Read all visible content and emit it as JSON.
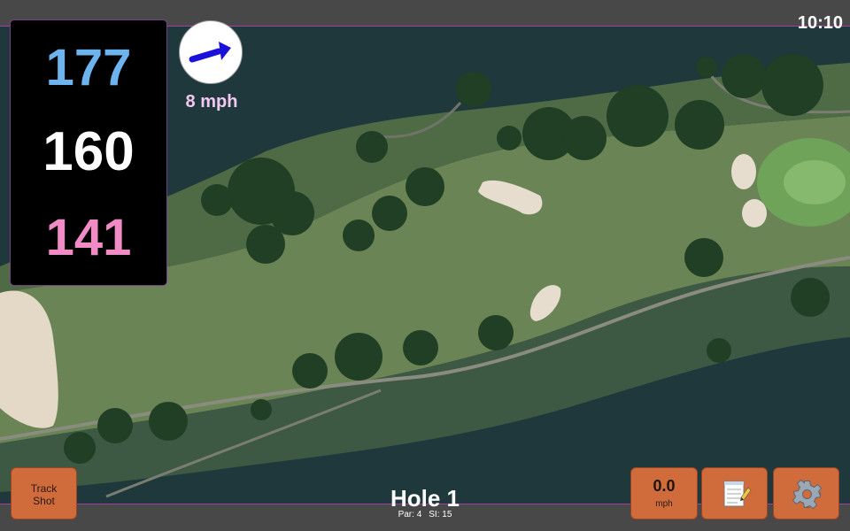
{
  "status": {
    "time": "10:10"
  },
  "distances": {
    "back": "177",
    "middle": "160",
    "front": "141"
  },
  "wind": {
    "speed": "8 mph",
    "icon": "wind-direction-arrow-icon"
  },
  "hole": {
    "title": "Hole 1",
    "par": "Par: 4",
    "si": "SI: 15"
  },
  "buttons": {
    "track_shot": {
      "line1": "Track",
      "line2": "Shot"
    },
    "speed": {
      "value": "0.0",
      "unit": "mph"
    },
    "notes": {
      "icon": "notepad-icon"
    },
    "settings": {
      "icon": "gear-icon"
    }
  },
  "colors": {
    "back": "#6db3ee",
    "middle": "#ffffff",
    "front": "#f08bc6",
    "button": "#d06b3c"
  }
}
